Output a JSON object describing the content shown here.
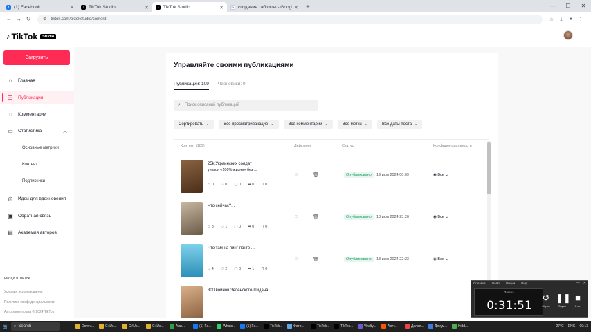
{
  "browser": {
    "tabs": [
      {
        "title": "(1) Facebook",
        "color": "#1877f2",
        "active": false
      },
      {
        "title": "TikTok Studio",
        "color": "#000000",
        "active": false
      },
      {
        "title": "TikTok Studio",
        "color": "#000000",
        "active": true
      },
      {
        "title": "создание таблицы - Google Search",
        "color": "#ffffff",
        "active": false
      }
    ],
    "new_tab": "+",
    "url": "tiktok.com/tiktokstudio/content"
  },
  "header": {
    "logo": "TikTok",
    "studio_badge": "Studio"
  },
  "sidebar": {
    "upload_label": "Загрузить",
    "items": [
      {
        "label": "Главная",
        "icon": "home-icon"
      },
      {
        "label": "Публикации",
        "icon": "list-icon",
        "active": true
      },
      {
        "label": "Комментарии",
        "icon": "comment-icon"
      },
      {
        "label": "Статистика",
        "icon": "chart-icon"
      }
    ],
    "stats_sub": [
      "Основные метрики",
      "Контент",
      "Подписчики"
    ],
    "items2": [
      {
        "label": "Идеи для вдохновения",
        "icon": "bulb-icon"
      },
      {
        "label": "Обратная связь",
        "icon": "feedback-icon"
      },
      {
        "label": "Академия авторов",
        "icon": "academy-icon"
      }
    ],
    "footer_title": "Назад в TikTok",
    "footer_lines": [
      "Условия использования",
      "Политика конфиденциальности",
      "Авторские права © 2024 TikTok"
    ]
  },
  "main": {
    "title": "Управляйте своими публикациями",
    "tabs": [
      {
        "label": "Публикации: 109",
        "active": true
      },
      {
        "label": "Черновики: 0",
        "active": false
      }
    ],
    "search_placeholder": "Поиск описаний публикаций",
    "filters": [
      "Сортировать",
      "Все просматривающие",
      "Все комментарии",
      "Все метки",
      "Все даты поста"
    ],
    "columns": [
      "Контент (109)",
      "Действия",
      "Статус",
      "Конфиденциальность"
    ],
    "rows": [
      {
        "title": "25k Украинских солдат",
        "subtitle": "учатся «100% жизни» без ...",
        "stats": {
          "views": "0",
          "likes": "0",
          "comments": "0",
          "shares": "0",
          "saves": "0"
        },
        "status": "Опубликовано",
        "date": "19 июл 2024 00:09",
        "privacy": "Все",
        "thumb": "#6a4a2e"
      },
      {
        "title": "Что сейчас?...",
        "subtitle": "",
        "stats": {
          "views": "3",
          "likes": "1",
          "comments": "0",
          "shares": "0",
          "saves": "0"
        },
        "status": "Опубликовано",
        "date": "18 июл 2024 23:26",
        "privacy": "Все",
        "thumb": "#8a7560"
      },
      {
        "title": "Что там на пинг-понге ...",
        "subtitle": "",
        "stats": {
          "views": "4",
          "likes": "2",
          "comments": "0",
          "shares": "1",
          "saves": "0"
        },
        "status": "Опубликовано",
        "date": "18 июл 2024 22:23",
        "privacy": "Все",
        "thumb": "#3aa3c8"
      },
      {
        "title": "300 воинов Зеленского-Пидана",
        "subtitle": "",
        "stats": {
          "views": "",
          "likes": "",
          "comments": "",
          "shares": "",
          "saves": ""
        },
        "status": "",
        "date": "",
        "privacy": "",
        "thumb": "#b08860"
      }
    ]
  },
  "recorder": {
    "menu": [
      "Справка",
      "Файл",
      "Опции",
      "Вид"
    ],
    "status": "Запись",
    "time": "0:31:51",
    "buttons": [
      "Сброс",
      "Пауза",
      "Стоп"
    ]
  },
  "taskbar": {
    "search": "Search",
    "apps": [
      "Downl...",
      "C:\\Us...",
      "C:\\Us...",
      "C:\\Us...",
      "Ави...",
      "(1) Fa...",
      "Whats...",
      "(1) Fa...",
      "TikTok...",
      "Фото...",
      "TikTok...",
      "TikTok...",
      "Viralty...",
      "Автт...",
      "Делая...",
      "Докум...",
      "Kidd..."
    ],
    "tray": [
      "27°C",
      "ENG",
      "09:13"
    ]
  }
}
